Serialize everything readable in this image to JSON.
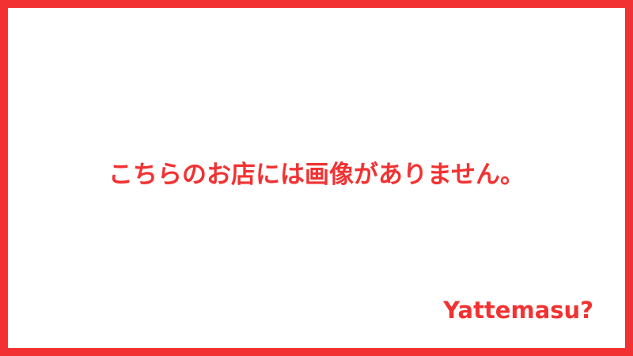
{
  "placeholder": {
    "message": "こちらのお店には画像がありません。",
    "brand": "Yattemasu?"
  },
  "colors": {
    "accent": "#f23232",
    "background": "#ffffff"
  }
}
